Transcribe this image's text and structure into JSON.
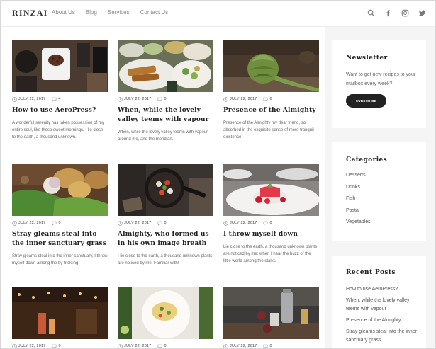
{
  "header": {
    "logo": "RINZAI",
    "nav": [
      "About Us",
      "Blog",
      "Services",
      "Contact Us"
    ],
    "icons": [
      "search-icon",
      "facebook-icon",
      "instagram-icon",
      "twitter-icon"
    ]
  },
  "posts": [
    {
      "date": "JULY 22, 2017",
      "comments": "4",
      "title": "How to use AeroPress?",
      "excerpt": "A wonderful serenity has taken possession of my entire soul, like these sweet mornings. I lie close to the earth, a thousand unknown."
    },
    {
      "date": "JULY 22, 2017",
      "comments": "0",
      "title": "When, while the lovely valley teems with vapour",
      "excerpt": "When, while the lovely valley teems with vapour around me, and the meridian."
    },
    {
      "date": "JULY 22, 2017",
      "comments": "0",
      "title": "Presence of the Almighty",
      "excerpt": "Presence of the Almighty my dear friend, so absorbed in the exquisite sense of mere tranquil existence."
    },
    {
      "date": "JULY 22, 2017",
      "comments": "0",
      "title": "Stray gleams steal into the inner sanctuary grass",
      "excerpt": "Stray gleams steal into the inner sanctuary, I throw myself down among the by trickling."
    },
    {
      "date": "JULY 22, 2017",
      "comments": "0",
      "title": "Almighty, who formed us in his own image breath",
      "excerpt": "I lie close to the earth, a thousand unknown plants are noticed by me. Familiar with!"
    },
    {
      "date": "JULY 22, 2017",
      "comments": "0",
      "title": "I throw myself down",
      "excerpt": "Lie close to the earth, a thousand unknown plants are noticed by me: when I hear the buzz of the little world among the stalks."
    },
    {
      "date": "JULY 22, 2017",
      "comments": "0"
    },
    {
      "date": "JULY 22, 2017",
      "comments": "0"
    },
    {
      "date": "JULY 22, 2017",
      "comments": "0"
    }
  ],
  "newsletter": {
    "title": "Newsletter",
    "text": "Want to get new recipes to your mailbox every week?",
    "button": "SUBSCRIBE"
  },
  "categories": {
    "title": "Categories",
    "items": [
      "Desserts",
      "Drinks",
      "Fish",
      "Pasta",
      "Vegetables"
    ]
  },
  "recent": {
    "title": "Recent Posts",
    "items": [
      "How to use AeroPress?",
      "When, while the lovely valley teems with vapour",
      "Presence of the Almighty",
      "Stray gleams steal into the inner sanctuary grass"
    ]
  }
}
